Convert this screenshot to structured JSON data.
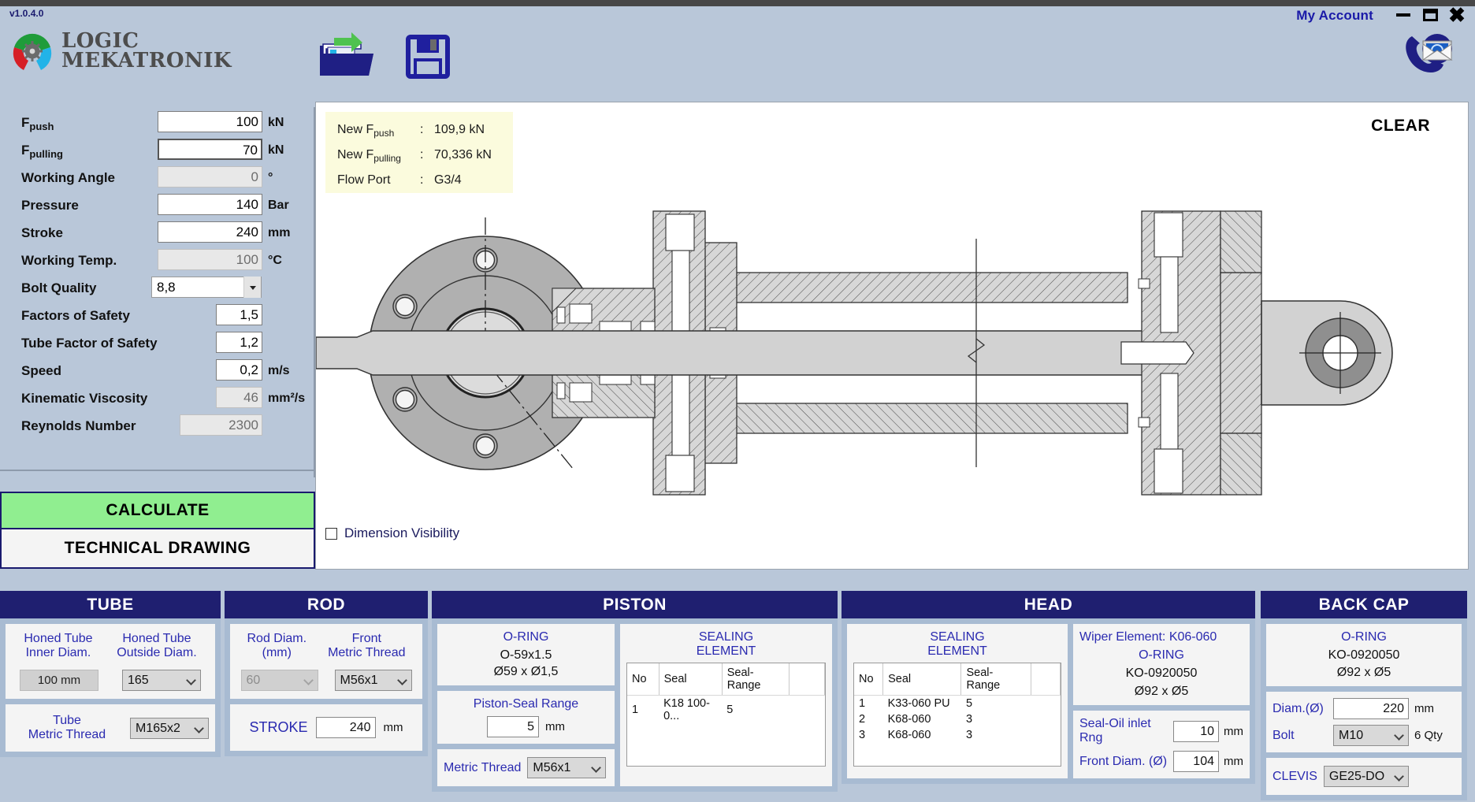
{
  "titlebar": {
    "version": "v1.0.4.0",
    "my_account": "My Account",
    "minimize": "minimize",
    "maximize": "maximize",
    "close": "✖"
  },
  "brand": {
    "line1": "LOGIC",
    "line2": "MEKATRONIK",
    "colors": {
      "green": "#1f9c3a",
      "red": "#d61f26",
      "blue": "#22b3e8",
      "gear": "#6b6b6b"
    }
  },
  "toolbar": {
    "open_icon": "open-folder-icon",
    "save_icon": "save-floppy-icon",
    "contact_icon": "phone-mail-icon"
  },
  "params": [
    {
      "label": "F",
      "sub": "push",
      "value": "100",
      "unit": "kN",
      "readonly": false,
      "type": "input"
    },
    {
      "label": "F",
      "sub": "pulling",
      "value": "70",
      "unit": "kN",
      "readonly": false,
      "type": "input"
    },
    {
      "label": "Working Angle",
      "value": "0",
      "unit": "°",
      "readonly": true,
      "type": "input"
    },
    {
      "label": "Pressure",
      "value": "140",
      "unit": "Bar",
      "readonly": false,
      "type": "input"
    },
    {
      "label": "Stroke",
      "value": "240",
      "unit": "mm",
      "readonly": false,
      "type": "input"
    },
    {
      "label": "Working Temp.",
      "value": "100",
      "unit": "°C",
      "readonly": true,
      "type": "input"
    },
    {
      "label": "Bolt Quality",
      "value": "8,8",
      "unit": "",
      "readonly": false,
      "type": "select"
    },
    {
      "label": "Factors of Safety",
      "value": "1,5",
      "unit": "",
      "readonly": false,
      "type": "input"
    },
    {
      "label": "Tube Factor of Safety",
      "value": "1,2",
      "unit": "",
      "readonly": false,
      "type": "input"
    },
    {
      "label": "Speed",
      "value": "0,2",
      "unit": "m/s",
      "readonly": false,
      "type": "input"
    },
    {
      "label": "Kinematic Viscosity",
      "value": "46",
      "unit": "mm²/s",
      "readonly": true,
      "type": "input"
    },
    {
      "label": "Reynolds Number",
      "value": "2300",
      "unit": "",
      "readonly": true,
      "type": "input"
    }
  ],
  "actions": {
    "calculate": "CALCULATE",
    "technical_drawing": "TECHNICAL DRAWING",
    "clear": "CLEAR"
  },
  "results": [
    {
      "key": "New F",
      "sub": "push",
      "colon": ":",
      "value": "109,9 kN"
    },
    {
      "key": "New F",
      "sub": "pulling",
      "colon": ":",
      "value": "70,336 kN"
    },
    {
      "key": "Flow Port",
      "sub": "",
      "colon": ":",
      "value": "G3/4"
    }
  ],
  "dimension_visibility": {
    "label": "Dimension Visibility",
    "checked": false
  },
  "sections": {
    "tube": {
      "title": "TUBE",
      "honed_inner_label_l1": "Honed Tube",
      "honed_inner_label_l2": "Inner Diam.",
      "honed_outer_label_l1": "Honed Tube",
      "honed_outer_label_l2": "Outside Diam.",
      "honed_inner_value": "100 mm",
      "honed_outer_value": "165",
      "thread_label_l1": "Tube",
      "thread_label_l2": "Metric Thread",
      "thread_value": "M165x2"
    },
    "rod": {
      "title": "ROD",
      "rod_diam_label_l1": "Rod Diam.",
      "rod_diam_label_l2": "(mm)",
      "front_thread_label_l1": "Front",
      "front_thread_label_l2": "Metric Thread",
      "rod_diam_value": "60",
      "front_thread_value": "M56x1",
      "stroke_label": "STROKE",
      "stroke_value": "240",
      "stroke_unit": "mm"
    },
    "piston": {
      "title": "PISTON",
      "oring_title": "O-RING",
      "oring_code": "O-59x1.5",
      "oring_dims": "Ø59 x Ø1,5",
      "seal_range_label": "Piston-Seal Range",
      "seal_range_value": "5",
      "seal_range_unit": "mm",
      "metric_thread_label": "Metric Thread",
      "metric_thread_value": "M56x1",
      "sealing_title_l1": "SEALING",
      "sealing_title_l2": "ELEMENT",
      "table_headers": [
        "No",
        "Seal",
        "Seal-Range",
        ""
      ],
      "table_rows": [
        [
          "1",
          "K18 100-0...",
          "5",
          ""
        ]
      ]
    },
    "head": {
      "title": "HEAD",
      "sealing_title_l1": "SEALING",
      "sealing_title_l2": "ELEMENT",
      "table_headers": [
        "No",
        "Seal",
        "Seal-Range",
        ""
      ],
      "table_rows": [
        [
          "1",
          "K33-060 PU",
          "5",
          ""
        ],
        [
          "2",
          "K68-060",
          "3",
          ""
        ],
        [
          "3",
          "K68-060",
          "3",
          ""
        ]
      ],
      "wiper_element": "Wiper Element: K06-060",
      "oring_title": "O-RING",
      "oring_code": "KO-0920050",
      "oring_dims": "Ø92 x Ø5",
      "seal_oil_label": "Seal-Oil inlet Rng",
      "seal_oil_value": "10",
      "seal_oil_unit": "mm",
      "front_diam_label": "Front Diam. (Ø)",
      "front_diam_value": "104",
      "front_diam_unit": "mm"
    },
    "backcap": {
      "title": "BACK CAP",
      "oring_title": "O-RING",
      "oring_code": "KO-0920050",
      "oring_dims": "Ø92 x Ø5",
      "diam_label": "Diam.(Ø)",
      "diam_value": "220",
      "diam_unit": "mm",
      "bolt_label": "Bolt",
      "bolt_value": "M10",
      "bolt_qty": "6 Qty",
      "clevis_label": "CLEVIS",
      "clevis_value": "GE25-DO"
    }
  },
  "drawing": {
    "front_view_name": "flange-front-view",
    "section_view_name": "cylinder-cross-section",
    "bolt_hole_count": 6
  }
}
